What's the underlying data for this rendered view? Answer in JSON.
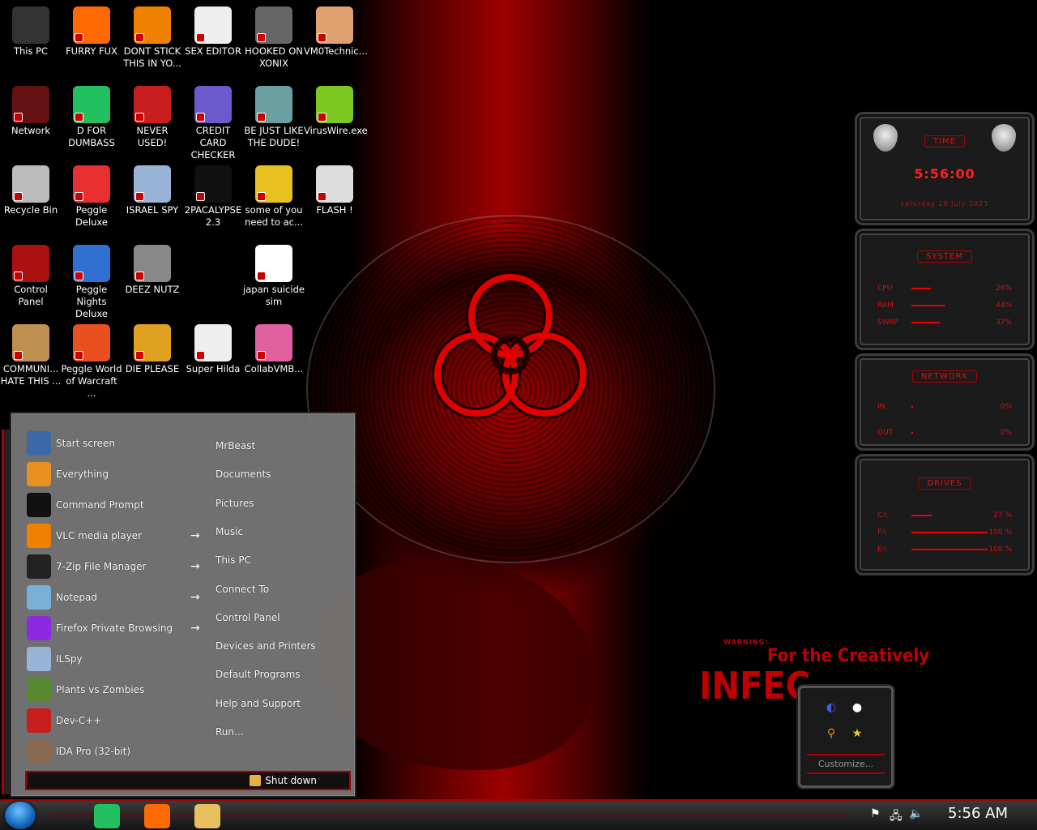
{
  "desktop_icons": [
    {
      "label": "This PC",
      "icon": "computer-icon",
      "color": "#333333"
    },
    {
      "label": "FURRY FUX",
      "icon": "firefox-icon",
      "color": "#ff6a00"
    },
    {
      "label": "DONT STICK THIS IN YO...",
      "icon": "vlc-cone-icon",
      "color": "#f08000"
    },
    {
      "label": "SEX EDITOR",
      "icon": "hxd-editor-icon",
      "color": "#eeeeee"
    },
    {
      "label": "HOOKED ON XONIX",
      "icon": "xonix-game-icon",
      "color": "#666666"
    },
    {
      "label": "VM0Technic...",
      "icon": "doctor-icon",
      "color": "#e0a070"
    },
    {
      "label": "Network",
      "icon": "network-orb-icon",
      "color": "#661111"
    },
    {
      "label": "D FOR DUMBASS",
      "icon": "spotify-style-icon",
      "color": "#22c060"
    },
    {
      "label": "NEVER USED!",
      "icon": "devcpp-icon",
      "color": "#c81e1e"
    },
    {
      "label": "CREDIT CARD CHECKER",
      "icon": "credit-card-icon",
      "color": "#6a5acd"
    },
    {
      "label": "BE JUST LIKE THE DUDE!",
      "icon": "santa-avatar-icon",
      "color": "#6aa0a0"
    },
    {
      "label": "VirusWire.exe",
      "icon": "limewire-icon",
      "color": "#7ac820"
    },
    {
      "label": "Recycle Bin",
      "icon": "recycle-bin-icon",
      "color": "#bbbbbb"
    },
    {
      "label": "Peggle Deluxe",
      "icon": "peggle-icon",
      "color": "#e83030"
    },
    {
      "label": "ISRAEL SPY",
      "icon": "spy-network-icon",
      "color": "#9ab4d8"
    },
    {
      "label": "2PACALYPSE 2.3",
      "icon": "console-icon",
      "color": "#111111"
    },
    {
      "label": "some of you need to ac...",
      "icon": "dog-icon",
      "color": "#e8c020"
    },
    {
      "label": "FLASH !",
      "icon": "flash-icon",
      "color": "#dddddd"
    },
    {
      "label": "Control Panel",
      "icon": "control-panel-icon",
      "color": "#aa1111"
    },
    {
      "label": "Peggle Nights Deluxe",
      "icon": "peggle-nights-icon",
      "color": "#3070d0"
    },
    {
      "label": "DEEZ NUTZ",
      "icon": "windows-stack-icon",
      "color": "#888888"
    },
    {
      "label": "japan suicide sim",
      "icon": "japan-sim-icon",
      "color": "#ffffff"
    },
    {
      "label": "COMMUNI... HATE THIS ...",
      "icon": "money-bag-icon",
      "color": "#c09050"
    },
    {
      "label": "Peggle World of Warcraft ...",
      "icon": "peggle-wow-icon",
      "color": "#e85020"
    },
    {
      "label": "DIE PLEASE",
      "icon": "de-icon",
      "color": "#e0a020"
    },
    {
      "label": "Super Hilda",
      "icon": "hilda-icon",
      "color": "#eeeeee"
    },
    {
      "label": "CollabVMB...",
      "icon": "collabvm-icon",
      "color": "#e060a0"
    }
  ],
  "gadgets": {
    "time": {
      "title": "TIME",
      "time": "5:56:00",
      "date": "saturday 29 july 2023"
    },
    "system": {
      "title": "SYSTEM",
      "rows": [
        {
          "name": "CPU",
          "value": "26%",
          "level": 0.26
        },
        {
          "name": "RAM",
          "value": "44%",
          "level": 0.44
        },
        {
          "name": "SWAP",
          "value": "37%",
          "level": 0.37
        }
      ]
    },
    "network": {
      "title": "NETWORK",
      "rows": [
        {
          "name": "IN",
          "value": "0%"
        },
        {
          "name": "OUT",
          "value": "0%"
        }
      ]
    },
    "drives": {
      "title": "DRIVES",
      "rows": [
        {
          "name": "C:\\",
          "value": "27 %",
          "level": 0.27
        },
        {
          "name": "F:\\",
          "value": "100 %",
          "level": 1.0
        },
        {
          "name": "E:\\",
          "value": "100 %",
          "level": 1.0
        }
      ]
    }
  },
  "warning": {
    "small": "WARNING:",
    "line2": "For the Creatively",
    "line3": "INFEC"
  },
  "tray_popup": {
    "customize": "Customize..."
  },
  "start_menu": {
    "left_items": [
      {
        "label": "Start screen",
        "icon": "start-screen-icon",
        "color": "#3a6aa8",
        "arrow": false
      },
      {
        "label": "Everything",
        "icon": "everything-search-icon",
        "color": "#e89020",
        "arrow": false
      },
      {
        "label": "Command Prompt",
        "icon": "command-prompt-icon",
        "color": "#111111",
        "arrow": false
      },
      {
        "label": "VLC media player",
        "icon": "vlc-icon",
        "color": "#f08000",
        "arrow": true
      },
      {
        "label": "7-Zip File Manager",
        "icon": "seven-zip-icon",
        "color": "#222222",
        "arrow": true
      },
      {
        "label": "Notepad",
        "icon": "notepad-icon",
        "color": "#7ab0d8",
        "arrow": true
      },
      {
        "label": "Firefox Private Browsing",
        "icon": "firefox-private-icon",
        "color": "#8a2be2",
        "arrow": true
      },
      {
        "label": "ILSpy",
        "icon": "ilspy-icon",
        "color": "#9ab4d8",
        "arrow": false
      },
      {
        "label": "Plants vs Zombies",
        "icon": "pvz-icon",
        "color": "#5a8a30",
        "arrow": false
      },
      {
        "label": "Dev-C++",
        "icon": "devcpp-icon",
        "color": "#c81e1e",
        "arrow": false
      },
      {
        "label": "IDA Pro (32-bit)",
        "icon": "ida-pro-icon",
        "color": "#8a6a50",
        "arrow": false
      }
    ],
    "right_items": [
      "MrBeast",
      "Documents",
      "Pictures",
      "Music",
      "This PC",
      "Connect To",
      "Control Panel",
      "Devices and Printers",
      "Default Programs",
      "Help and Support",
      "Run..."
    ],
    "shutdown_label": "Shut down"
  },
  "taskbar": {
    "pinned": [
      {
        "icon": "spotify-style-icon",
        "color": "#22c060"
      },
      {
        "icon": "firefox-icon",
        "color": "#ff6a00"
      },
      {
        "icon": "file-explorer-icon",
        "color": "#e8c060"
      }
    ],
    "clock": "5:56 AM"
  }
}
